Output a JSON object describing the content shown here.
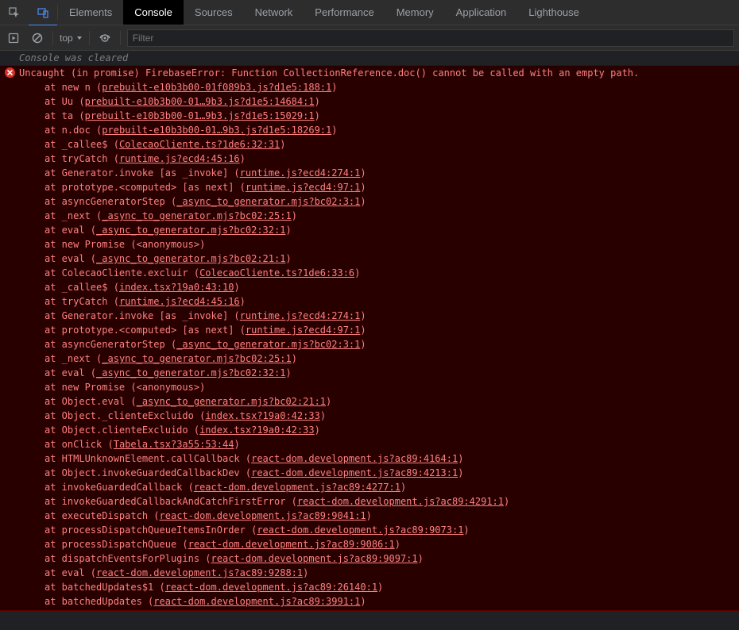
{
  "tabs": {
    "items": [
      "Elements",
      "Console",
      "Sources",
      "Network",
      "Performance",
      "Memory",
      "Application",
      "Lighthouse"
    ],
    "activeIndex": 1
  },
  "toolbar": {
    "scope_label": "top",
    "filter_placeholder": "Filter"
  },
  "console": {
    "cleared_msg": "Console was cleared",
    "error_header": "Uncaught (in promise) FirebaseError: Function CollectionReference.doc() cannot be called with an empty path.",
    "stack": [
      {
        "fn": "new n",
        "loc": "prebuilt-e10b3b00-01f089b3.js?d1e5:188:1"
      },
      {
        "fn": "Uu",
        "loc": "prebuilt-e10b3b00-01…9b3.js?d1e5:14684:1"
      },
      {
        "fn": "ta",
        "loc": "prebuilt-e10b3b00-01…9b3.js?d1e5:15029:1"
      },
      {
        "fn": "n.doc",
        "loc": "prebuilt-e10b3b00-01…9b3.js?d1e5:18269:1"
      },
      {
        "fn": "_callee$",
        "loc": "ColecaoCliente.ts?1de6:32:31"
      },
      {
        "fn": "tryCatch",
        "loc": "runtime.js?ecd4:45:16"
      },
      {
        "fn": "Generator.invoke [as _invoke]",
        "loc": "runtime.js?ecd4:274:1"
      },
      {
        "fn": "prototype.<computed> [as next]",
        "loc": "runtime.js?ecd4:97:1"
      },
      {
        "fn": "asyncGeneratorStep",
        "loc": "_async_to_generator.mjs?bc02:3:1"
      },
      {
        "fn": "_next",
        "loc": "_async_to_generator.mjs?bc02:25:1"
      },
      {
        "fn": "eval",
        "loc": "_async_to_generator.mjs?bc02:32:1"
      },
      {
        "fn": "new Promise",
        "loc": "<anonymous>",
        "nolink": true
      },
      {
        "fn": "eval",
        "loc": "_async_to_generator.mjs?bc02:21:1"
      },
      {
        "fn": "ColecaoCliente.excluir",
        "loc": "ColecaoCliente.ts?1de6:33:6"
      },
      {
        "fn": "_callee$",
        "loc": "index.tsx?19a0:43:10"
      },
      {
        "fn": "tryCatch",
        "loc": "runtime.js?ecd4:45:16"
      },
      {
        "fn": "Generator.invoke [as _invoke]",
        "loc": "runtime.js?ecd4:274:1"
      },
      {
        "fn": "prototype.<computed> [as next]",
        "loc": "runtime.js?ecd4:97:1"
      },
      {
        "fn": "asyncGeneratorStep",
        "loc": "_async_to_generator.mjs?bc02:3:1"
      },
      {
        "fn": "_next",
        "loc": "_async_to_generator.mjs?bc02:25:1"
      },
      {
        "fn": "eval",
        "loc": "_async_to_generator.mjs?bc02:32:1"
      },
      {
        "fn": "new Promise",
        "loc": "<anonymous>",
        "nolink": true
      },
      {
        "fn": "Object.eval",
        "loc": "_async_to_generator.mjs?bc02:21:1"
      },
      {
        "fn": "Object._clienteExcluido",
        "loc": "index.tsx?19a0:42:33"
      },
      {
        "fn": "Object.clienteExcluido",
        "loc": "index.tsx?19a0:42:33"
      },
      {
        "fn": "onClick",
        "loc": "Tabela.tsx?3a55:53:44"
      },
      {
        "fn": "HTMLUnknownElement.callCallback",
        "loc": "react-dom.development.js?ac89:4164:1"
      },
      {
        "fn": "Object.invokeGuardedCallbackDev",
        "loc": "react-dom.development.js?ac89:4213:1"
      },
      {
        "fn": "invokeGuardedCallback",
        "loc": "react-dom.development.js?ac89:4277:1"
      },
      {
        "fn": "invokeGuardedCallbackAndCatchFirstError",
        "loc": "react-dom.development.js?ac89:4291:1"
      },
      {
        "fn": "executeDispatch",
        "loc": "react-dom.development.js?ac89:9041:1"
      },
      {
        "fn": "processDispatchQueueItemsInOrder",
        "loc": "react-dom.development.js?ac89:9073:1"
      },
      {
        "fn": "processDispatchQueue",
        "loc": "react-dom.development.js?ac89:9086:1"
      },
      {
        "fn": "dispatchEventsForPlugins",
        "loc": "react-dom.development.js?ac89:9097:1"
      },
      {
        "fn": "eval",
        "loc": "react-dom.development.js?ac89:9288:1"
      },
      {
        "fn": "batchedUpdates$1",
        "loc": "react-dom.development.js?ac89:26140:1"
      },
      {
        "fn": "batchedUpdates",
        "loc": "react-dom.development.js?ac89:3991:1"
      }
    ]
  }
}
